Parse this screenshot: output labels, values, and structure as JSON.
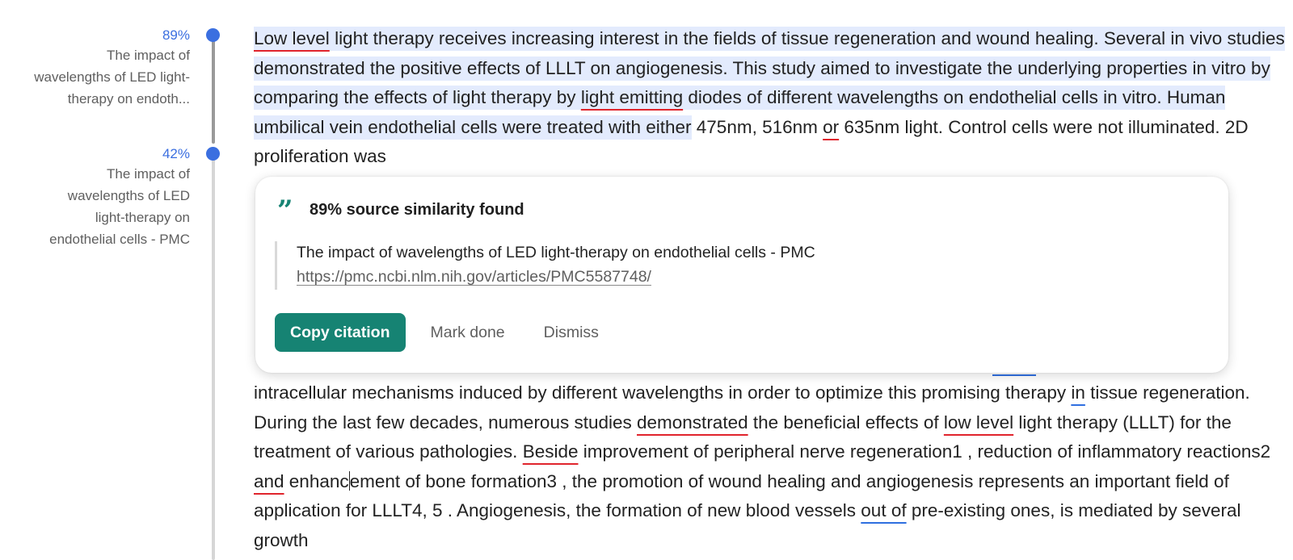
{
  "sidebar": {
    "sources": [
      {
        "percent": "89%",
        "title_lines": [
          "The impact of",
          "wavelengths of LED light-",
          "therapy on endoth..."
        ]
      },
      {
        "percent": "42%",
        "title_lines": [
          "The impact of",
          "wavelengths of LED",
          "light-therapy on",
          "endothelial cells - PMC"
        ]
      }
    ]
  },
  "document": {
    "highlighted": {
      "l1_a": "Low level",
      "l1_b": " light therapy receives increasing interest in the fields of tissue regeneration and wound healing. Several in vivo studies demonstrated the positive effects of LLLT on angiogenesis. This study aimed to investigate the underlying properties in vitro by comparing the effects of light therapy by ",
      "l3_u": "light emitting",
      "l3_b": " diodes of different wavelengths on endothelial cells in vitro. Human umbilical vein endothelial cells were treated with either"
    },
    "after_highlight_a": " 475nm, 516nm ",
    "after_highlight_u": "or",
    "after_highlight_b": " 635nm light. Control cells were not illuminated. 2D proliferation was",
    "lower": {
      "p1_a": "intracellular mechanisms induced by different wavelengths in order to optimize this promising therapy ",
      "p1_u": "in",
      "p1_b": " tissue regeneration. During the last few decades, numerous studies ",
      "p1_u2": "demonstrated",
      "p1_c": " the beneficial effects of ",
      "p1_u3": "low level",
      "p1_d": " light therapy (LLLT) for the treatment of various pathologies. ",
      "p1_u4": "Beside",
      "p1_e": " improvement of peripheral nerve regeneration1 , reduction of inflammatory reactions2 ",
      "p1_u5": "and",
      "p1_f1": " enhanc",
      "p1_f2": "ement of bone formation3 , the promotion of wound healing and angiogenesis represents an important field of application for LLLT4, 5 . Angiogenesis, the formation of new blood vessels ",
      "p1_u6": "out of",
      "p1_g": " pre-existing ones, is mediated by several growth"
    }
  },
  "popup": {
    "quote_glyph": "”",
    "title": "89% source similarity found",
    "source_title": "The impact of wavelengths of LED light-therapy on endothelial cells - PMC",
    "source_url": "https://pmc.ncbi.nlm.nih.gov/articles/PMC5587748/",
    "buttons": {
      "copy": "Copy citation",
      "mark_done": "Mark done",
      "dismiss": "Dismiss"
    }
  },
  "colors": {
    "accent_blue": "#3b6fe0",
    "highlight": "#e3ebfd",
    "brand_green": "#168373",
    "error_red": "#e0242c"
  }
}
